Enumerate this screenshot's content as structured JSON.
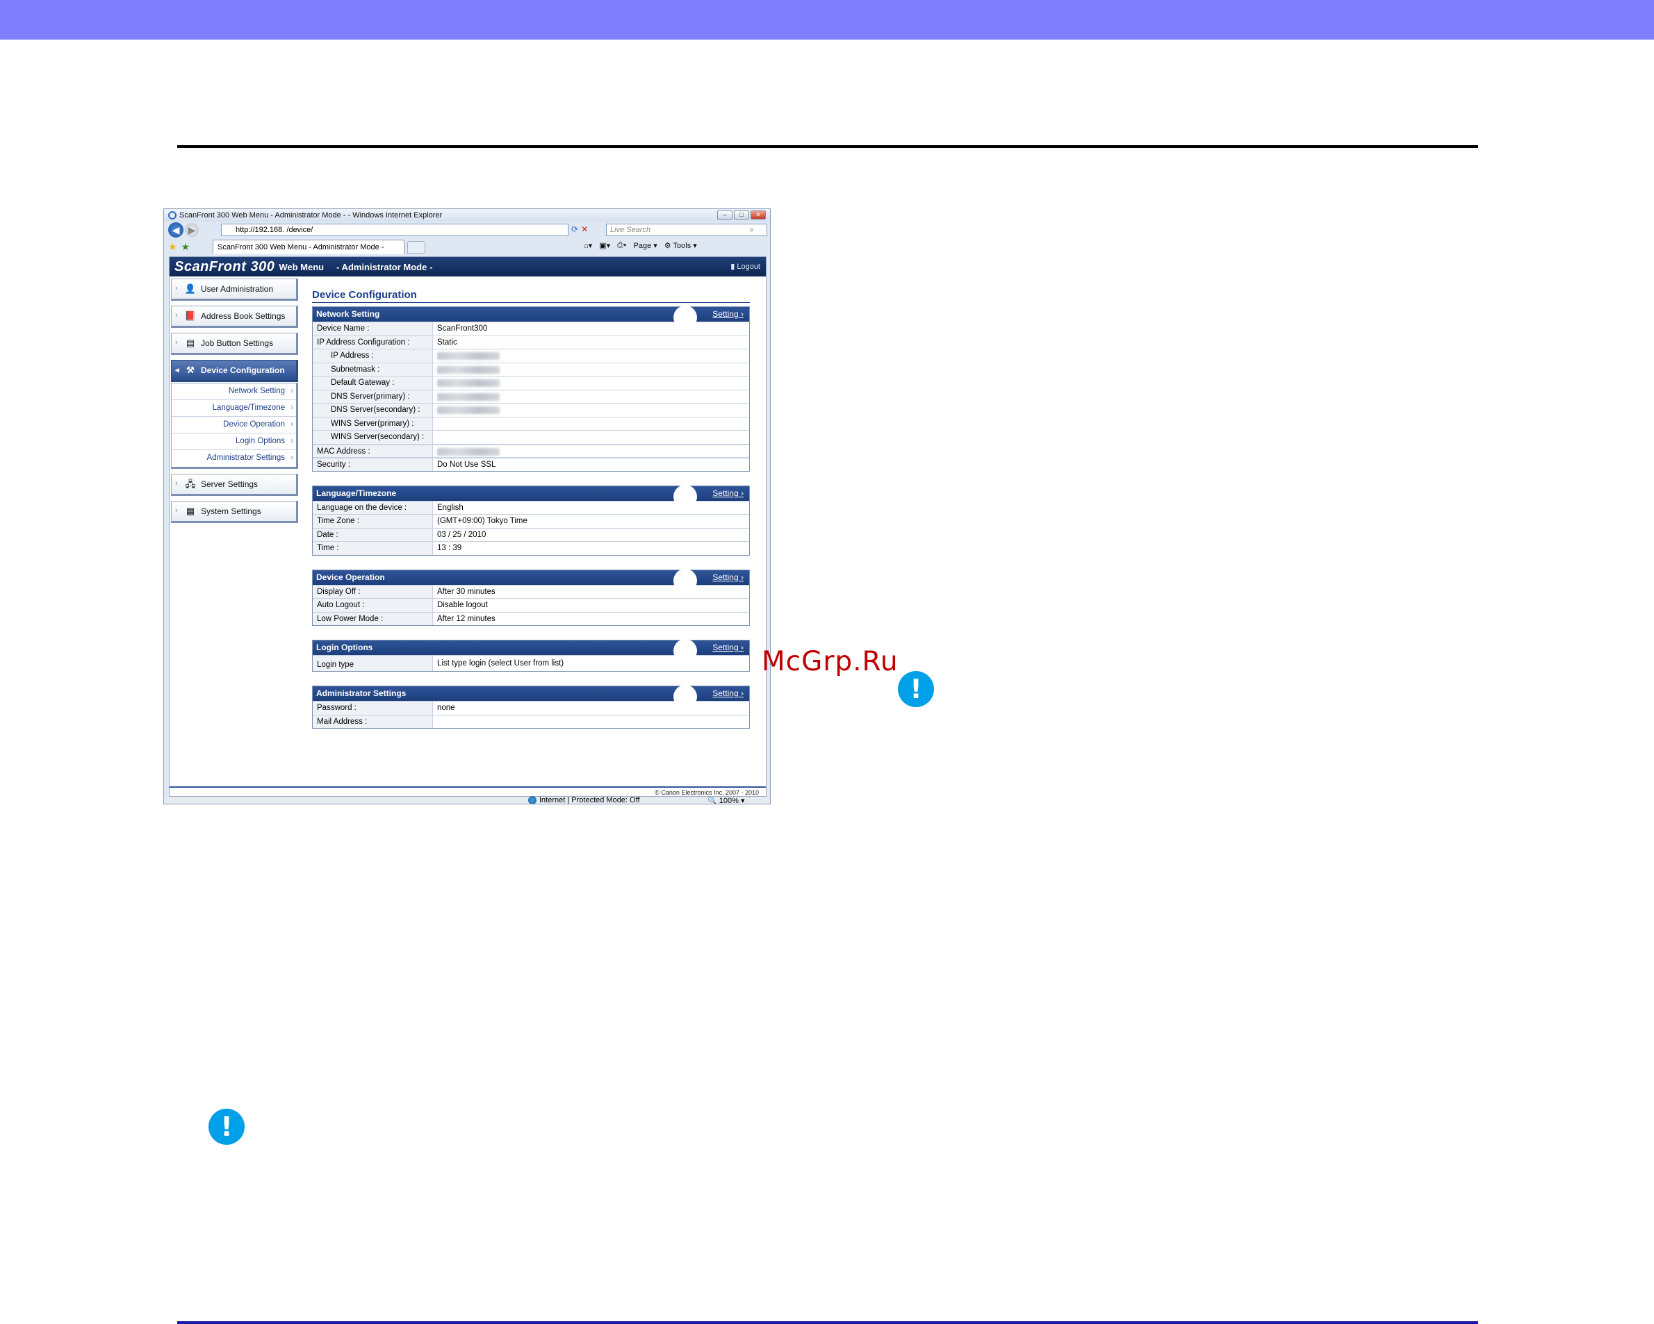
{
  "colors": {
    "top_band": "#8080ff",
    "rule_top": "#000000",
    "rule_bottom": "#1a1aa0",
    "header_navy": "#1d3f7c",
    "link_blue": "#1c3f8a",
    "alert_blue": "#00a0e8",
    "watermark_red": "#c00000"
  },
  "watermark": "McGrp.Ru",
  "alerts": {
    "icon": "alert-exclamation-icon",
    "glyph": "!"
  },
  "browser": {
    "title": "ScanFront 300 Web Menu - Administrator Mode - - Windows Internet Explorer",
    "window_buttons": [
      "–",
      "□",
      "✕"
    ],
    "address": "http://192.168.      /device/",
    "search_placeholder": "Live Search",
    "tab_label": "ScanFront 300 Web Menu - Administrator Mode -",
    "commands": {
      "page": "Page",
      "tools": "Tools"
    },
    "status": "Internet | Protected Mode: Off",
    "zoom": "100%"
  },
  "app": {
    "logo": "ScanFront 300",
    "logo_sub": "Web Menu",
    "mode": "- Administrator Mode -",
    "logout": "Logout",
    "footer": "© Canon Electronics Inc. 2007 - 2010"
  },
  "sidebar": {
    "items": [
      {
        "label": "User Administration",
        "icon": "user-icon"
      },
      {
        "label": "Address Book Settings",
        "icon": "address-book-icon"
      },
      {
        "label": "Job Button Settings",
        "icon": "job-button-icon"
      },
      {
        "label": "Device Configuration",
        "icon": "device-config-icon"
      },
      {
        "label": "Server Settings",
        "icon": "server-icon"
      },
      {
        "label": "System Settings",
        "icon": "system-icon"
      }
    ],
    "submenu": [
      "Network Setting",
      "Language/Timezone",
      "Device Operation",
      "Login Options",
      "Administrator Settings"
    ]
  },
  "content": {
    "title": "Device Configuration",
    "setting_link": "Setting",
    "network": {
      "title": "Network Setting",
      "rows": [
        {
          "k": "Device Name :",
          "v": "ScanFront300"
        },
        {
          "k": "IP Address Configuration :",
          "v": "Static"
        },
        {
          "k": "IP Address :",
          "v": ""
        },
        {
          "k": "Subnetmask :",
          "v": ""
        },
        {
          "k": "Default Gateway :",
          "v": ""
        },
        {
          "k": "DNS Server(primary) :",
          "v": ""
        },
        {
          "k": "DNS Server(secondary) :",
          "v": ""
        },
        {
          "k": "WINS Server(primary) :",
          "v": ""
        },
        {
          "k": "WINS Server(secondary) :",
          "v": ""
        },
        {
          "k": "MAC Address :",
          "v": ""
        },
        {
          "k": "Security :",
          "v": "Do Not Use SSL"
        }
      ]
    },
    "language": {
      "title": "Language/Timezone",
      "rows": [
        {
          "k": "Language on the device :",
          "v": "English"
        },
        {
          "k": "Time Zone :",
          "v": "(GMT+09:00) Tokyo Time"
        },
        {
          "k": "Date :",
          "v": "03 / 25 / 2010"
        },
        {
          "k": "Time :",
          "v": "13 : 39"
        }
      ]
    },
    "operation": {
      "title": "Device Operation",
      "rows": [
        {
          "k": "Display Off :",
          "v": "After 30 minutes"
        },
        {
          "k": "Auto Logout :",
          "v": "Disable logout"
        },
        {
          "k": "Low Power Mode :",
          "v": "After 12 minutes"
        }
      ]
    },
    "login": {
      "title": "Login Options",
      "rows": [
        {
          "k": "Login type",
          "v": "List type login (select User from list)"
        }
      ]
    },
    "admin": {
      "title": "Administrator Settings",
      "rows": [
        {
          "k": "Password :",
          "v": "none"
        },
        {
          "k": "Mail Address :",
          "v": ""
        }
      ]
    }
  }
}
